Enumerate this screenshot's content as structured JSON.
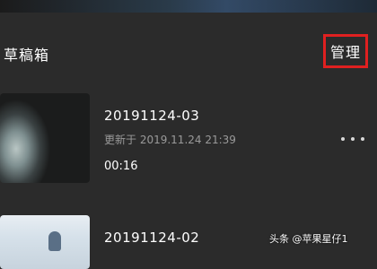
{
  "header": {
    "title": "草稿箱",
    "manage_label": "管理"
  },
  "drafts": [
    {
      "name": "20191124-03",
      "updated": "更新于 2019.11.24 21:39",
      "duration": "00:16"
    },
    {
      "name": "20191124-02"
    }
  ],
  "icons": {
    "more": "more-horizontal-icon"
  },
  "colors": {
    "background": "#2b2b2b",
    "highlight_border": "#e02020",
    "secondary_text": "#9a9a9a"
  },
  "watermark": "头条 @苹果星仔1"
}
